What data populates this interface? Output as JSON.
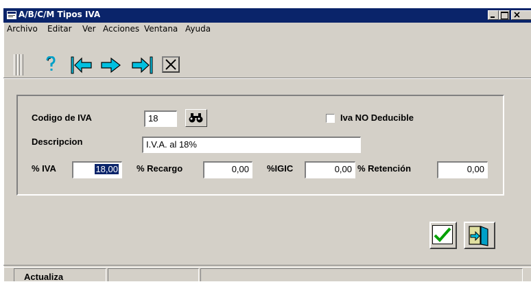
{
  "window": {
    "title": "A/B/C/M Tipos IVA"
  },
  "menu": [
    "Archivo",
    "Editar",
    "Ver",
    "Acciones",
    "Ventana",
    "Ayuda"
  ],
  "toolbar": {
    "help_icon": "question-mark-icon",
    "first_icon": "first-record-icon",
    "next_icon": "next-arrow-icon",
    "last_icon": "last-record-icon",
    "close_icon": "close-x-icon"
  },
  "form": {
    "codigo_label": "Codigo de IVA",
    "codigo_value": "18",
    "no_deducible_label": "Iva NO Deducible",
    "no_deducible_checked": false,
    "descripcion_label": "Descripcion",
    "descripcion_value": "I.V.A. al 18%",
    "iva_label": "% IVA",
    "iva_value": "18,00",
    "recargo_label": "% Recargo",
    "recargo_value": "0,00",
    "igic_label": "%IGIC",
    "igic_value": "0,00",
    "retencion_label": "% Retención",
    "retencion_value": "0,00"
  },
  "status": {
    "cell1": "Actualiza"
  },
  "colors": {
    "titlebar": "#0a246a",
    "face": "#d4d0c8",
    "accent_cyan": "#00a0c8"
  }
}
